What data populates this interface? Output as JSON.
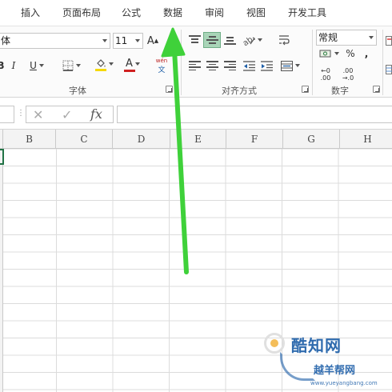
{
  "ribbon_tabs": [
    "插入",
    "页面布局",
    "公式",
    "数据",
    "审阅",
    "视图",
    "开发工具"
  ],
  "font_group": {
    "font_name": "体",
    "font_size": "11",
    "bold": "B",
    "italic": "I",
    "underline": "U",
    "grow_font": "A",
    "shrink_font": "A",
    "font_color_glyph": "A",
    "pinyin_top": "wén",
    "pinyin_bottom": "文",
    "label": "字体"
  },
  "alignment_group": {
    "label": "对齐方式"
  },
  "number_group": {
    "format_value": "常规",
    "percent": "%",
    "comma": ",",
    "inc_decimal_top": "←0",
    "inc_decimal_bottom": ".00",
    "dec_decimal_top": ".00",
    "dec_decimal_bottom": "→.0",
    "label": "数字"
  },
  "formula_bar": {
    "cancel_glyph": "✕",
    "enter_glyph": "✓",
    "fx_label": "fx",
    "value": ""
  },
  "columns": [
    "B",
    "C",
    "D",
    "E",
    "F",
    "G",
    "H"
  ],
  "colors": {
    "arrow": "#3fd13a",
    "active_cell": "#217346",
    "font_color_bar": "#d02020",
    "fill_color_bar": "#f5d800",
    "watermark": "#1e5fa8"
  },
  "watermark": {
    "title": "酷知网",
    "subtitle": "越羊帮网",
    "url": "www.yueyangbang.com"
  }
}
